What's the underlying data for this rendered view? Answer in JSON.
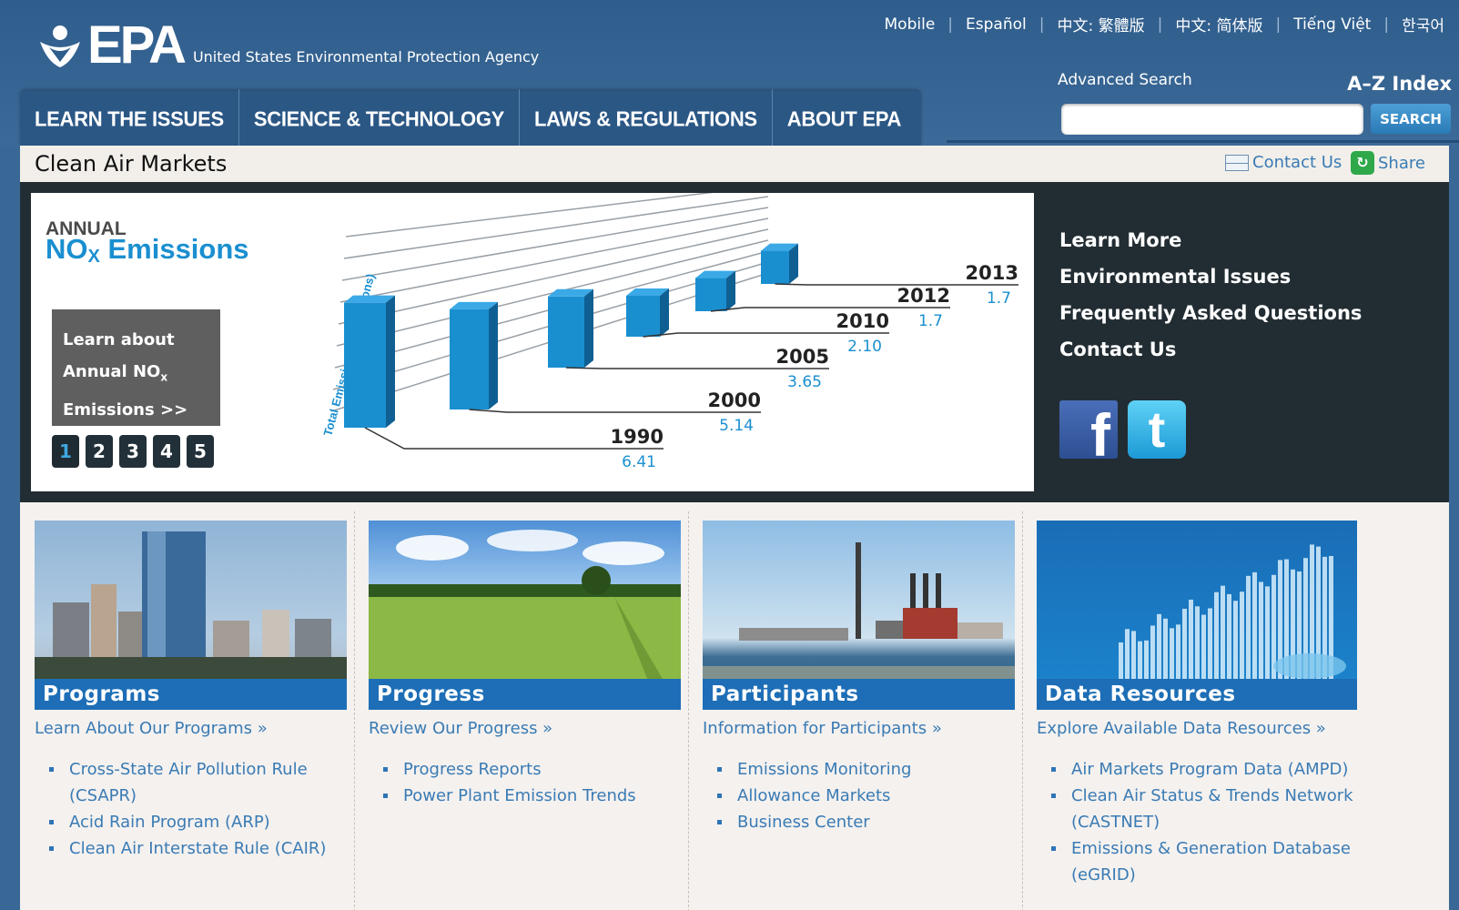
{
  "header": {
    "logo_text": "EPA",
    "agency_name": "United States Environmental Protection Agency",
    "languages": [
      "Mobile",
      "Español",
      "中文: 繁體版",
      "中文: 简体版",
      "Tiếng Việt",
      "한국어"
    ],
    "advanced_search": "Advanced Search",
    "az_index": "A–Z Index",
    "search_placeholder": "",
    "search_button": "SEARCH"
  },
  "nav": {
    "items": [
      "LEARN THE ISSUES",
      "SCIENCE & TECHNOLOGY",
      "LAWS & REGULATIONS",
      "ABOUT EPA"
    ]
  },
  "title_bar": {
    "title": "Clean Air Markets",
    "contact": "Contact Us",
    "share": "Share"
  },
  "feature": {
    "slide_annual": "ANNUAL",
    "slide_nox": "NO",
    "slide_nox_sub": "X",
    "slide_emissions": "Emissions",
    "learn_line1": "Learn about",
    "learn_line2": "Annual NO",
    "learn_line2_sub": "x",
    "learn_line3": "Emissions >>",
    "pager": [
      "1",
      "2",
      "3",
      "4",
      "5"
    ],
    "side_links": [
      "Learn More",
      "Environmental Issues",
      "Frequently Asked Questions",
      "Contact Us"
    ],
    "facebook_icon": "facebook-icon",
    "twitter_icon": "twitter-icon"
  },
  "chart_data": {
    "type": "bar",
    "title": "ANNUAL NOx Emissions",
    "ylabel": "Total Emissions (million tons)",
    "categories": [
      "1990",
      "2000",
      "2005",
      "2010",
      "2012",
      "2013"
    ],
    "values": [
      6.41,
      5.14,
      3.65,
      2.1,
      1.7,
      1.7
    ],
    "value_labels": [
      "6.41",
      "5.14",
      "3.65",
      "2.10",
      "1.7",
      "1.7"
    ],
    "bar_color": "#1a8fd0",
    "label_color": "#1a8fd0"
  },
  "columns": [
    {
      "label": "Programs",
      "link": "Learn About Our Programs »",
      "items": [
        "Cross-State Air Pollution Rule (CSAPR)",
        "Acid Rain Program (ARP)",
        "Clean Air Interstate Rule (CAIR)"
      ]
    },
    {
      "label": "Progress",
      "link": "Review Our Progress »",
      "items": [
        "Progress Reports",
        "Power Plant Emission Trends"
      ]
    },
    {
      "label": "Participants",
      "link": "Information for Participants »",
      "items": [
        "Emissions Monitoring",
        "Allowance Markets",
        "Business Center"
      ]
    },
    {
      "label": "Data Resources",
      "link": "Explore Available Data Resources »",
      "items": [
        "Air Markets Program Data (AMPD)",
        "Clean Air Status & Trends Network (CASTNET)",
        "Emissions & Generation Database (eGRID)"
      ]
    }
  ],
  "colors": {
    "header_blue": "#3a6896",
    "accent_blue": "#1d6eb6",
    "link_blue": "#3a7bb4",
    "dark_band": "#222d33"
  }
}
